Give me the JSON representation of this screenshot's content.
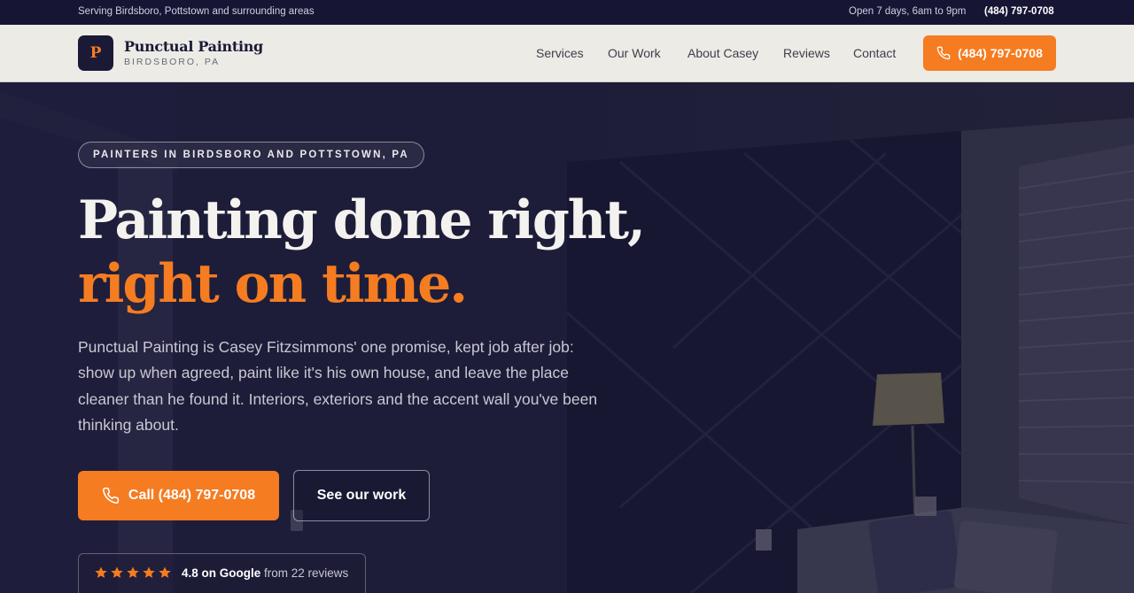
{
  "topbar": {
    "service_area": "Serving Birdsboro, Pottstown and surrounding areas",
    "hours": "Open 7 days, 6am to 9pm",
    "phone": "(484) 797-0708"
  },
  "header": {
    "logo_letter": "P",
    "brand_name": "Punctual Painting",
    "brand_location": "BIRDSBORO, PA",
    "nav": {
      "services": "Services",
      "our_work": "Our Work",
      "about": "About Casey",
      "reviews": "Reviews",
      "contact": "Contact"
    },
    "cta_phone": "(484) 797-0708"
  },
  "hero": {
    "eyebrow": "PAINTERS IN BIRDSBORO AND POTTSTOWN, PA",
    "headline_line1": "Painting done right,",
    "headline_line2": "right on time.",
    "lead": "Punctual Painting is Casey Fitzsimmons' one promise, kept job after job: show up when agreed, paint like it's his own house, and leave the place cleaner than he found it. Interiors, exteriors and the accent wall you've been thinking about.",
    "call_button": "Call (484) 797-0708",
    "work_button": "See our work",
    "rating": {
      "stars": 5,
      "score_label": "4.8 on Google",
      "reviews_label": "from 22 reviews"
    }
  },
  "colors": {
    "accent": "#f57c21",
    "navy": "#1b1a36",
    "header_bg": "#ecebe6"
  },
  "icons": [
    "phone-icon",
    "star-icon"
  ]
}
